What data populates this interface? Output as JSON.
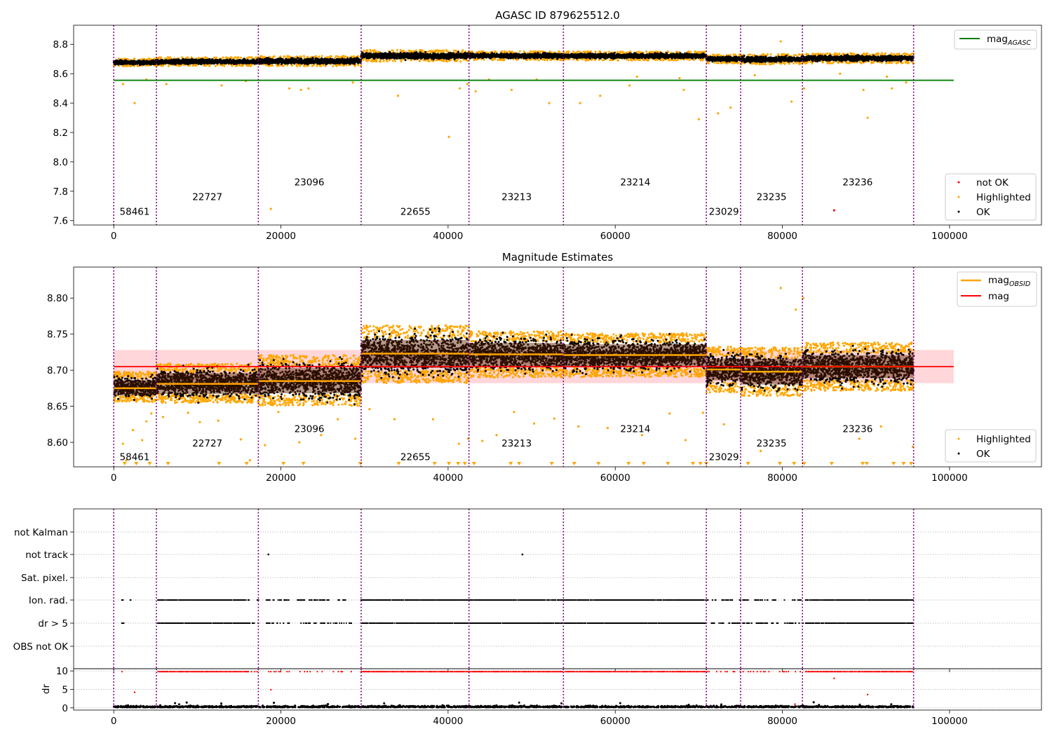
{
  "figure": {
    "colors": {
      "ok": "#000000",
      "highlighted": "#ffa500",
      "not_ok": "#ff0000",
      "agasc_line": "#008000",
      "mag_line": "#ff0000",
      "obsid_line": "#ffa500",
      "obs_boundary": "#800080",
      "mag_band": "#ffd6d9"
    }
  },
  "chart_data": [
    {
      "type": "scatter",
      "title": "AGASC ID 879625512.0",
      "xlabel": "",
      "ylabel": "",
      "xlim": [
        -4800,
        111000
      ],
      "ylim": [
        7.57,
        8.93
      ],
      "xticks": [
        0,
        20000,
        40000,
        60000,
        80000,
        100000
      ],
      "xtick_labels": [
        "0",
        "20000",
        "40000",
        "60000",
        "80000",
        "100000"
      ],
      "yticks": [
        7.6,
        7.8,
        8.0,
        8.2,
        8.4,
        8.6,
        8.8
      ],
      "ytick_labels": [
        "7.6",
        "7.8",
        "8.0",
        "8.2",
        "8.4",
        "8.6",
        "8.8"
      ],
      "grid": false,
      "legend_upper": {
        "placement": "top-right",
        "entries": [
          "mag$_{AGASC}$"
        ]
      },
      "legend_lower": {
        "placement": "bottom-right",
        "entries": [
          "not OK",
          "Highlighted",
          "OK"
        ]
      },
      "reference_lines": [
        {
          "name": "mag$_{AGASC}$",
          "y": 8.555,
          "x_range": [
            0,
            100500
          ]
        }
      ],
      "obs_boundaries": [
        0,
        5100,
        17300,
        29600,
        42500,
        53800,
        70900,
        75000,
        82400,
        95700
      ],
      "obs_labels": [
        {
          "text": "58461",
          "x": 2500,
          "y": 7.64
        },
        {
          "text": "22727",
          "x": 11200,
          "y": 7.74
        },
        {
          "text": "23096",
          "x": 23400,
          "y": 7.84
        },
        {
          "text": "22655",
          "x": 36100,
          "y": 7.64
        },
        {
          "text": "23213",
          "x": 48200,
          "y": 7.74
        },
        {
          "text": "23214",
          "x": 62400,
          "y": 7.84
        },
        {
          "text": "23029",
          "x": 73000,
          "y": 7.64
        },
        {
          "text": "23235",
          "x": 78700,
          "y": 7.74
        },
        {
          "text": "23236",
          "x": 89000,
          "y": 7.84
        }
      ],
      "series": [
        {
          "name": "OK",
          "segments": [
            {
              "x_range": [
                0,
                5100
              ],
              "y_center": 8.677,
              "y_spread": 0.012
            },
            {
              "x_range": [
                5100,
                17300
              ],
              "y_center": 8.682,
              "y_spread": 0.014
            },
            {
              "x_range": [
                17300,
                29600
              ],
              "y_center": 8.686,
              "y_spread": 0.016
            },
            {
              "x_range": [
                29600,
                42500
              ],
              "y_center": 8.722,
              "y_spread": 0.018
            },
            {
              "x_range": [
                42500,
                53800
              ],
              "y_center": 8.722,
              "y_spread": 0.014
            },
            {
              "x_range": [
                53800,
                70900
              ],
              "y_center": 8.721,
              "y_spread": 0.014
            },
            {
              "x_range": [
                70900,
                75000
              ],
              "y_center": 8.701,
              "y_spread": 0.014
            },
            {
              "x_range": [
                75000,
                82400
              ],
              "y_center": 8.698,
              "y_spread": 0.016
            },
            {
              "x_range": [
                82400,
                95700
              ],
              "y_center": 8.705,
              "y_spread": 0.016
            }
          ]
        },
        {
          "name": "Highlighted",
          "points": [
            [
              2500,
              8.4
            ],
            [
              18800,
              7.68
            ],
            [
              21000,
              8.5
            ],
            [
              22400,
              8.49
            ],
            [
              23300,
              8.5
            ],
            [
              34000,
              8.45
            ],
            [
              40100,
              8.17
            ],
            [
              41400,
              8.5
            ],
            [
              42300,
              8.53
            ],
            [
              43300,
              8.48
            ],
            [
              47600,
              8.49
            ],
            [
              52100,
              8.4
            ],
            [
              55800,
              8.4
            ],
            [
              58200,
              8.45
            ],
            [
              61700,
              8.52
            ],
            [
              68200,
              8.49
            ],
            [
              70000,
              8.29
            ],
            [
              72300,
              8.33
            ],
            [
              73800,
              8.37
            ],
            [
              79800,
              8.82
            ],
            [
              81100,
              8.41
            ],
            [
              82600,
              8.5
            ],
            [
              89700,
              8.49
            ],
            [
              90200,
              8.3
            ],
            [
              93100,
              8.5
            ],
            [
              94800,
              8.54
            ],
            [
              1100,
              8.53
            ],
            [
              3900,
              8.56
            ],
            [
              6300,
              8.53
            ],
            [
              12900,
              8.52
            ],
            [
              15800,
              8.55
            ],
            [
              28600,
              8.54
            ],
            [
              44900,
              8.56
            ],
            [
              50600,
              8.56
            ],
            [
              62600,
              8.58
            ],
            [
              67700,
              8.57
            ],
            [
              76700,
              8.59
            ],
            [
              86900,
              8.6
            ],
            [
              92500,
              8.58
            ]
          ]
        },
        {
          "name": "not OK",
          "points": [
            [
              86200,
              7.67
            ]
          ]
        }
      ]
    },
    {
      "type": "scatter",
      "title": "Magnitude Estimates",
      "xlabel": "",
      "ylabel": "",
      "xlim": [
        -4800,
        111000
      ],
      "ylim": [
        8.566,
        8.843
      ],
      "xticks": [
        0,
        20000,
        40000,
        60000,
        80000,
        100000
      ],
      "xtick_labels": [
        "0",
        "20000",
        "40000",
        "60000",
        "80000",
        "100000"
      ],
      "yticks": [
        8.6,
        8.65,
        8.7,
        8.75,
        8.8
      ],
      "ytick_labels": [
        "8.60",
        "8.65",
        "8.70",
        "8.75",
        "8.80"
      ],
      "grid": false,
      "legend_upper": {
        "placement": "top-right",
        "entries": [
          "mag$_{OBSID}$",
          "mag"
        ]
      },
      "legend_lower": {
        "placement": "bottom-right",
        "entries": [
          "Highlighted",
          "OK"
        ]
      },
      "mag": {
        "value": 8.705,
        "band": [
          8.682,
          8.728
        ],
        "x_range": [
          0,
          100500
        ]
      },
      "obs_boundaries": [
        0,
        5100,
        17300,
        29600,
        42500,
        53800,
        70900,
        75000,
        82400,
        95700
      ],
      "obs_labels": [
        {
          "text": "58461",
          "x": 2500,
          "y": 8.575
        },
        {
          "text": "22727",
          "x": 11200,
          "y": 8.594
        },
        {
          "text": "23096",
          "x": 23400,
          "y": 8.614
        },
        {
          "text": "22655",
          "x": 36100,
          "y": 8.575
        },
        {
          "text": "23213",
          "x": 48200,
          "y": 8.594
        },
        {
          "text": "23214",
          "x": 62400,
          "y": 8.614
        },
        {
          "text": "23029",
          "x": 73000,
          "y": 8.575
        },
        {
          "text": "23235",
          "x": 78700,
          "y": 8.594
        },
        {
          "text": "23236",
          "x": 89000,
          "y": 8.614
        }
      ],
      "mag_obsid": [
        {
          "x_range": [
            0,
            5100
          ],
          "value": 8.675,
          "band": [
            8.665,
            8.686
          ]
        },
        {
          "x_range": [
            5100,
            17300
          ],
          "value": 8.681,
          "band": [
            8.667,
            8.696
          ]
        },
        {
          "x_range": [
            17300,
            29600
          ],
          "value": 8.685,
          "band": [
            8.668,
            8.703
          ]
        },
        {
          "x_range": [
            29600,
            42500
          ],
          "value": 8.723,
          "band": [
            8.703,
            8.742
          ]
        },
        {
          "x_range": [
            42500,
            53800
          ],
          "value": 8.722,
          "band": [
            8.706,
            8.738
          ]
        },
        {
          "x_range": [
            53800,
            70900
          ],
          "value": 8.721,
          "band": [
            8.706,
            8.736
          ]
        },
        {
          "x_range": [
            70900,
            75000
          ],
          "value": 8.701,
          "band": [
            8.686,
            8.716
          ]
        },
        {
          "x_range": [
            75000,
            82400
          ],
          "value": 8.698,
          "band": [
            8.68,
            8.716
          ]
        },
        {
          "x_range": [
            82400,
            95700
          ],
          "value": 8.705,
          "band": [
            8.689,
            8.721
          ]
        }
      ],
      "series": [
        {
          "name": "OK",
          "segments": [
            {
              "x_range": [
                0,
                5100
              ],
              "y_center": 8.677,
              "y_spread": 0.013
            },
            {
              "x_range": [
                5100,
                17300
              ],
              "y_center": 8.682,
              "y_spread": 0.017
            },
            {
              "x_range": [
                17300,
                29600
              ],
              "y_center": 8.686,
              "y_spread": 0.022
            },
            {
              "x_range": [
                29600,
                42500
              ],
              "y_center": 8.722,
              "y_spread": 0.025
            },
            {
              "x_range": [
                42500,
                53800
              ],
              "y_center": 8.722,
              "y_spread": 0.02
            },
            {
              "x_range": [
                53800,
                70900
              ],
              "y_center": 8.721,
              "y_spread": 0.019
            },
            {
              "x_range": [
                70900,
                75000
              ],
              "y_center": 8.701,
              "y_spread": 0.02
            },
            {
              "x_range": [
                75000,
                82400
              ],
              "y_center": 8.698,
              "y_spread": 0.021
            },
            {
              "x_range": [
                82400,
                95700
              ],
              "y_center": 8.705,
              "y_spread": 0.021
            }
          ]
        },
        {
          "name": "Highlighted",
          "points": [
            [
              1100,
              8.598
            ],
            [
              1500,
              8.575
            ],
            [
              2300,
              8.617
            ],
            [
              3400,
              8.603
            ],
            [
              3900,
              8.629
            ],
            [
              4500,
              8.64
            ],
            [
              5900,
              8.635
            ],
            [
              10300,
              8.628
            ],
            [
              12500,
              8.63
            ],
            [
              15200,
              8.604
            ],
            [
              16300,
              8.575
            ],
            [
              18100,
              8.596
            ],
            [
              22200,
              8.6
            ],
            [
              24800,
              8.61
            ],
            [
              26800,
              8.632
            ],
            [
              28900,
              8.605
            ],
            [
              30600,
              8.646
            ],
            [
              33600,
              8.632
            ],
            [
              38200,
              8.632
            ],
            [
              41300,
              8.598
            ],
            [
              42400,
              8.605
            ],
            [
              44100,
              8.602
            ],
            [
              45800,
              8.61
            ],
            [
              50300,
              8.626
            ],
            [
              52700,
              8.633
            ],
            [
              55600,
              8.622
            ],
            [
              59100,
              8.62
            ],
            [
              63200,
              8.61
            ],
            [
              66500,
              8.64
            ],
            [
              68400,
              8.603
            ],
            [
              70500,
              8.641
            ],
            [
              73000,
              8.625
            ],
            [
              77400,
              8.588
            ],
            [
              79800,
              8.814
            ],
            [
              81600,
              8.784
            ],
            [
              82500,
              8.8
            ],
            [
              89200,
              8.605
            ],
            [
              91800,
              8.622
            ],
            [
              95600,
              8.594
            ],
            [
              8900,
              8.641
            ],
            [
              19700,
              8.642
            ],
            [
              47900,
              8.642
            ]
          ]
        },
        {
          "name": "Highlighted (below axis)",
          "x": [
            1300,
            2700,
            4300,
            6500,
            12600,
            15900,
            20300,
            22700,
            29500,
            34100,
            38400,
            40100,
            41200,
            42000,
            43100,
            47500,
            48500,
            52400,
            55100,
            58000,
            61600,
            63400,
            66300,
            69300,
            70200,
            70900,
            75900,
            79700,
            81400,
            82600,
            85900,
            89600,
            90100,
            93300,
            94500,
            95400
          ]
        }
      ]
    },
    {
      "type": "scatter",
      "title": "",
      "xlabel": "",
      "ylabel": "",
      "xlim": [
        -4800,
        111000
      ],
      "yticks_labels": [
        "not Kalman",
        "not track",
        "Sat. pixel.",
        "Ion. rad.",
        "dr > 5",
        "OBS not OK"
      ],
      "grid": true,
      "obs_boundaries": [
        0,
        5100,
        17300,
        29600,
        42500,
        53800,
        70900,
        75000,
        82400,
        95700
      ],
      "flag_points": {
        "not Kalman": [],
        "not track": [
          18500,
          48900
        ],
        "Sat. pixel.": [],
        "Ion. rad.": "scattered observations between 0 and 95700, dense from 29600 to 53800",
        "dr > 5": "scattered observations between 0 and 95700, dense from 29600 to 53800",
        "OBS not OK": []
      },
      "ion_rad_ranges": [
        [
          1000,
          1100
        ],
        [
          2000,
          2300
        ],
        [
          5300,
          16000
        ],
        [
          16100,
          17300
        ],
        [
          18300,
          21000
        ],
        [
          22000,
          28500
        ],
        [
          29600,
          53800
        ],
        [
          54000,
          70900
        ],
        [
          71000,
          75000
        ],
        [
          75300,
          82400
        ],
        [
          82800,
          95700
        ]
      ]
    },
    {
      "type": "scatter",
      "title": "",
      "xlabel": "",
      "ylabel": "dr",
      "xlim": [
        -4800,
        111000
      ],
      "ylim": [
        -0.6,
        10.6
      ],
      "yticks": [
        0,
        5,
        10
      ],
      "ytick_labels": [
        "0",
        "5",
        "10"
      ],
      "xticks": [
        0,
        20000,
        40000,
        60000,
        80000,
        100000
      ],
      "xtick_labels": [
        "0",
        "20000",
        "40000",
        "60000",
        "80000",
        "100000"
      ],
      "grid": true,
      "obs_boundaries": [
        0,
        5100,
        17300,
        29600,
        42500,
        53800,
        70900,
        75000,
        82400,
        95700
      ],
      "series": [
        {
          "name": "OK",
          "y_range": [
            0,
            1.5
          ],
          "x_range": [
            0,
            95700
          ]
        },
        {
          "name": "not OK",
          "clipped_value": 9.8,
          "points": [
            [
              2500,
              4.2
            ],
            [
              18800,
              4.9
            ],
            [
              86200,
              8.0
            ],
            [
              90200,
              3.6
            ],
            [
              81500,
              1.0
            ]
          ]
        }
      ]
    }
  ]
}
